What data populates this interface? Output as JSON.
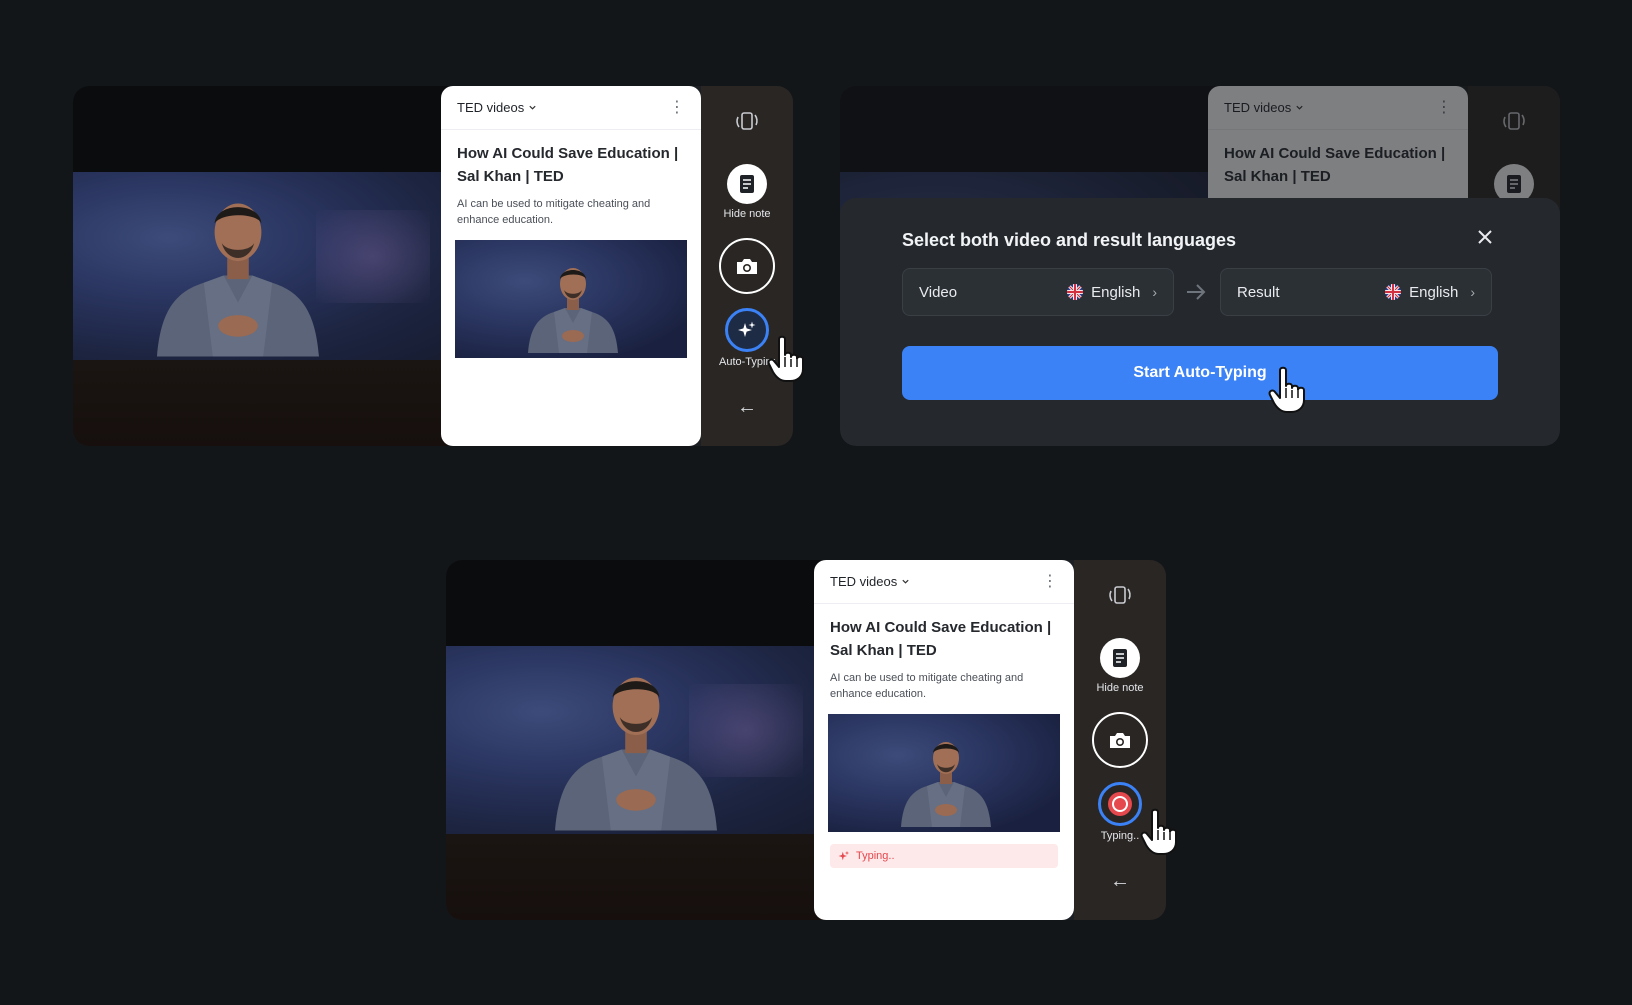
{
  "note": {
    "folder": "TED videos",
    "title": "How AI Could Save  Education | Sal Khan | TED",
    "description": "AI can be used to mitigate cheating and enhance education."
  },
  "toolbar": {
    "hide_note_label": "Hide note",
    "auto_typing_label": "Auto-Typing",
    "typing_label": "Typing.."
  },
  "typing_status": "Typing..",
  "dialog": {
    "title": "Select both video and result languages",
    "video_label": "Video",
    "video_language": "English",
    "result_label": "Result",
    "result_language": "English",
    "start_button": "Start Auto-Typing"
  },
  "colors": {
    "accent": "#3b82f6",
    "typing_red": "#e5484d",
    "background": "#131619"
  }
}
